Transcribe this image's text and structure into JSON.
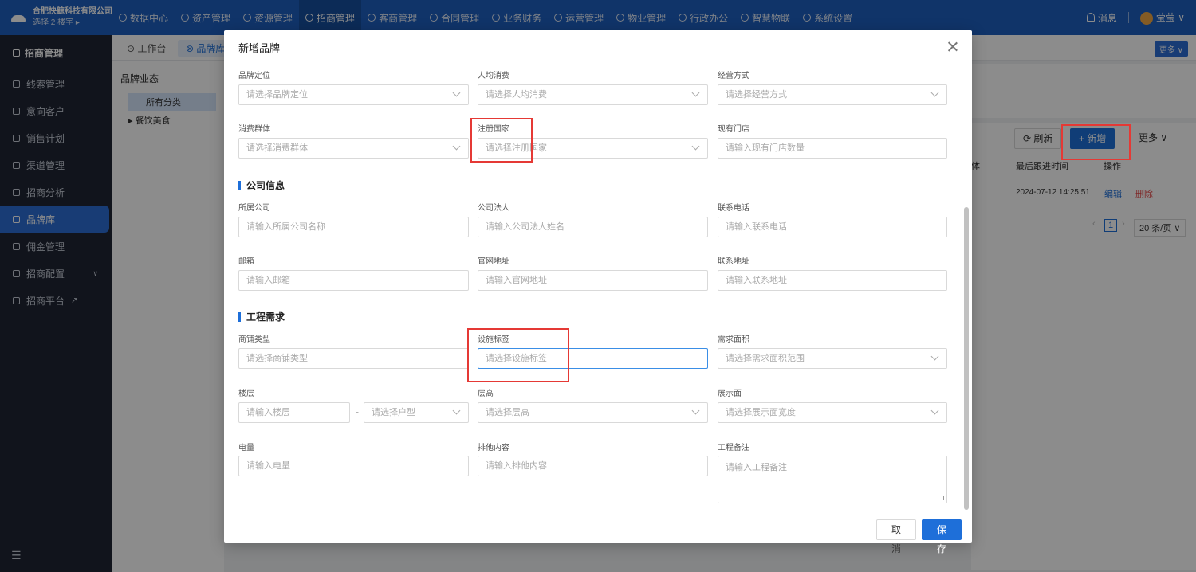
{
  "topbar": {
    "company": "合肥快鲸科技有限公司",
    "building": "选择 2 楼宇 ▸",
    "nav": [
      "数据中心",
      "资产管理",
      "资源管理",
      "招商管理",
      "客商管理",
      "合同管理",
      "业务财务",
      "运营管理",
      "物业管理",
      "行政办公",
      "智慧物联",
      "系统设置"
    ],
    "active_nav": "招商管理",
    "messages": "消息",
    "user": "莹莹 ∨"
  },
  "sidebar": {
    "title": "招商管理",
    "items": [
      "线索管理",
      "意向客户",
      "销售计划",
      "渠道管理",
      "招商分析",
      "品牌库",
      "佣金管理",
      "招商配置",
      "招商平台"
    ],
    "active": "品牌库"
  },
  "tabs": {
    "workbench": "工作台",
    "brand": "品牌库"
  },
  "more_chip": "更多 ∨",
  "tree": {
    "title": "品牌业态",
    "selected": "所有分类",
    "node": "▸ 餐饮美食"
  },
  "toolbar": {
    "refresh": "⟳ 刷新",
    "add": "+ 新增",
    "more": "更多 ∨"
  },
  "table": {
    "headers": [
      "体",
      "最后跟进时间",
      "操作"
    ],
    "row": {
      "time": "2024-07-12 14:25:51",
      "edit": "编辑",
      "delete": "删除"
    }
  },
  "pager": {
    "current": "1",
    "size": "20 条/页 ∨"
  },
  "modal": {
    "title": "新增品牌",
    "sections": {
      "company": "公司信息",
      "engineering": "工程需求"
    },
    "fields": {
      "positioning": {
        "label": "品牌定位",
        "placeholder": "请选择品牌定位"
      },
      "avg_spend": {
        "label": "人均消费",
        "placeholder": "请选择人均消费"
      },
      "operation": {
        "label": "经营方式",
        "placeholder": "请选择经营方式"
      },
      "consumer": {
        "label": "消费群体",
        "placeholder": "请选择消费群体"
      },
      "country": {
        "label": "注册国家",
        "placeholder": "请选择注册国家"
      },
      "stores": {
        "label": "现有门店",
        "placeholder": "请输入现有门店数量"
      },
      "company": {
        "label": "所属公司",
        "placeholder": "请输入所属公司名称"
      },
      "legal": {
        "label": "公司法人",
        "placeholder": "请输入公司法人姓名"
      },
      "phone": {
        "label": "联系电话",
        "placeholder": "请输入联系电话"
      },
      "email": {
        "label": "邮箱",
        "placeholder": "请输入邮箱"
      },
      "website": {
        "label": "官网地址",
        "placeholder": "请输入官网地址"
      },
      "address": {
        "label": "联系地址",
        "placeholder": "请输入联系地址"
      },
      "shop_type": {
        "label": "商铺类型",
        "placeholder": "请选择商铺类型"
      },
      "facility": {
        "label": "设施标签",
        "placeholder": "请选择设施标签"
      },
      "area": {
        "label": "需求面积",
        "placeholder": "请选择需求面积范围"
      },
      "floor": {
        "label": "楼层",
        "placeholder": "请输入楼层",
        "type_placeholder": "请选择户型"
      },
      "height": {
        "label": "层高",
        "placeholder": "请选择层高"
      },
      "display": {
        "label": "展示面",
        "placeholder": "请选择展示面宽度"
      },
      "power": {
        "label": "电量",
        "placeholder": "请输入电量"
      },
      "exclusive": {
        "label": "排他内容",
        "placeholder": "请输入排他内容"
      },
      "note": {
        "label": "工程备注",
        "placeholder": "请输入工程备注"
      }
    },
    "buttons": {
      "cancel": "取 消",
      "save": "保 存"
    }
  },
  "colors": {
    "primary": "#1e6fd9",
    "topbar": "#1e5fbf",
    "sidebar": "#1f2533",
    "highlight": "#e53935"
  }
}
